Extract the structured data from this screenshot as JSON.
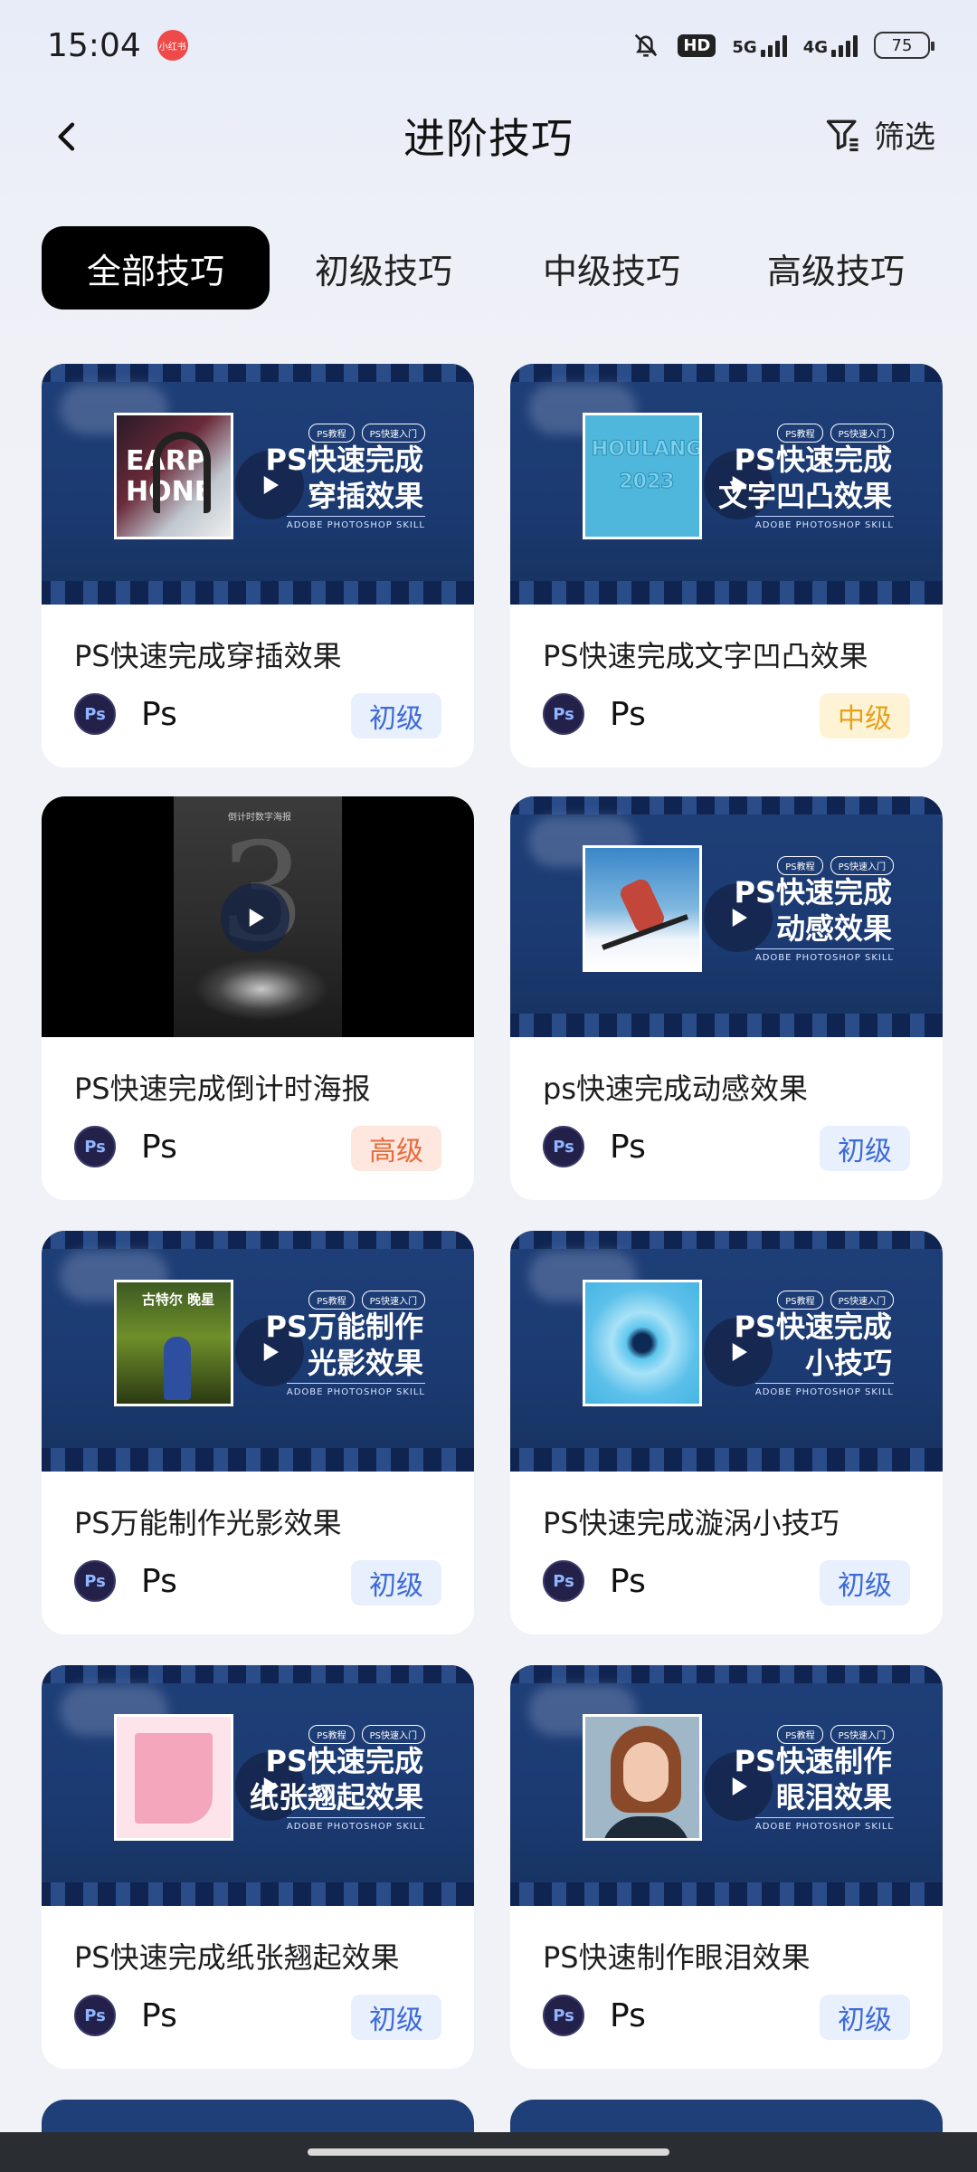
{
  "status": {
    "time": "15:04",
    "app_badge": "小红书",
    "hd": "HD",
    "net1": "5G",
    "net2": "4G",
    "battery": "75"
  },
  "nav": {
    "title": "进阶技巧",
    "filter_label": "筛选"
  },
  "tabs": [
    {
      "label": "全部技巧",
      "active": true
    },
    {
      "label": "初级技巧",
      "active": false
    },
    {
      "label": "中级技巧",
      "active": false
    },
    {
      "label": "高级技巧",
      "active": false
    }
  ],
  "cards": [
    {
      "title": "PS快速完成穿插效果",
      "thumb_title_1": "PS快速完成",
      "thumb_title_2": "穿插效果",
      "tool": "Ps",
      "level": "初级",
      "level_type": "beginner",
      "photo_text": "EARP HONE",
      "tag1": "PS教程",
      "tag2": "PS快速入门",
      "sub": "ADOBE PHOTOSHOP SKILL"
    },
    {
      "title": "PS快速完成文字凹凸效果",
      "thumb_title_1": "PS快速完成",
      "thumb_title_2": "文字凹凸效果",
      "tool": "Ps",
      "level": "中级",
      "level_type": "mid",
      "photo_text": "HOULANG 2023",
      "tag1": "PS教程",
      "tag2": "PS快速入门",
      "sub": "ADOBE PHOTOSHOP SKILL"
    },
    {
      "title": "PS快速完成倒计时海报",
      "thumb_title_1": "",
      "thumb_title_2": "",
      "tool": "Ps",
      "level": "高级",
      "level_type": "adv",
      "photo_text": "倒计时数字海报",
      "tag1": "",
      "tag2": "",
      "sub": ""
    },
    {
      "title": "ps快速完成动感效果",
      "thumb_title_1": "PS快速完成",
      "thumb_title_2": "动感效果",
      "tool": "Ps",
      "level": "初级",
      "level_type": "beginner",
      "photo_text": "",
      "tag1": "PS教程",
      "tag2": "PS快速入门",
      "sub": "ADOBE PHOTOSHOP SKILL"
    },
    {
      "title": "PS万能制作光影效果",
      "thumb_title_1": "PS万能制作",
      "thumb_title_2": "光影效果",
      "tool": "Ps",
      "level": "初级",
      "level_type": "beginner",
      "photo_text": "古特尔 晚星",
      "tag1": "PS教程",
      "tag2": "PS快速入门",
      "sub": "ADOBE PHOTOSHOP SKILL"
    },
    {
      "title": "PS快速完成漩涡小技巧",
      "thumb_title_1": "PS快速完成",
      "thumb_title_2": "小技巧",
      "tool": "Ps",
      "level": "初级",
      "level_type": "beginner",
      "photo_text": "",
      "tag1": "PS教程",
      "tag2": "PS快速入门",
      "sub": "ADOBE PHOTOSHOP SKILL"
    },
    {
      "title": "PS快速完成纸张翘起效果",
      "thumb_title_1": "PS快速完成",
      "thumb_title_2": "纸张翘起效果",
      "tool": "Ps",
      "level": "初级",
      "level_type": "beginner",
      "photo_text": "",
      "tag1": "PS教程",
      "tag2": "PS快速入门",
      "sub": "ADOBE PHOTOSHOP SKILL"
    },
    {
      "title": "PS快速制作眼泪效果",
      "thumb_title_1": "PS快速制作",
      "thumb_title_2": "眼泪效果",
      "tool": "Ps",
      "level": "初级",
      "level_type": "beginner",
      "photo_text": "",
      "tag1": "PS教程",
      "tag2": "PS快速入门",
      "sub": "ADOBE PHOTOSHOP SKILL"
    }
  ],
  "colors": {
    "tab_active_bg": "#000000",
    "beginner": "#3c6bd7",
    "mid": "#e6a11a",
    "advanced": "#e86c3d",
    "thumb_bg": "#1f3f78"
  }
}
